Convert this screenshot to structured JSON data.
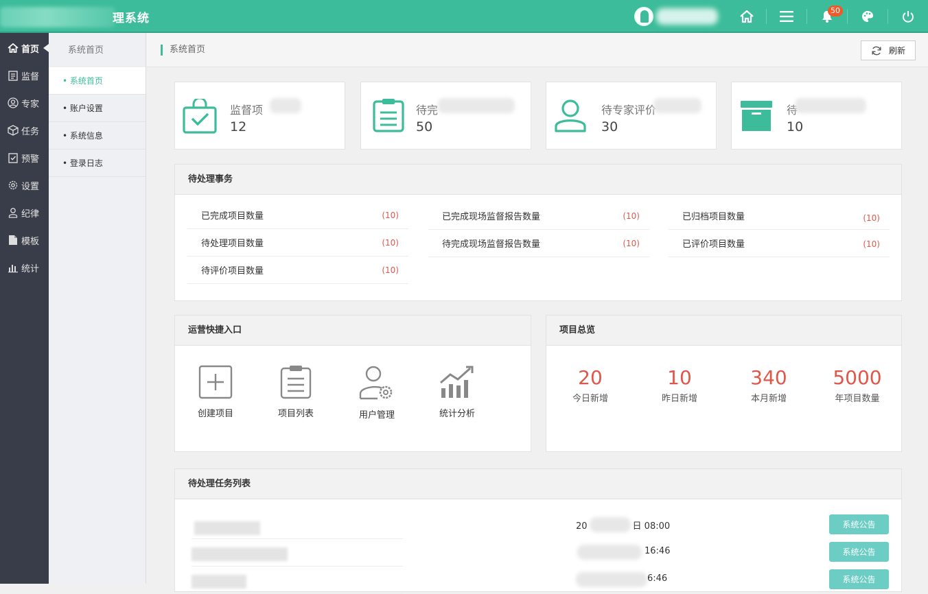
{
  "header": {
    "app_title": "理系统",
    "notification_count": "50"
  },
  "sidebar": {
    "items": [
      {
        "label": "首页",
        "icon": "home-icon"
      },
      {
        "label": "监督",
        "icon": "clipboard-icon"
      },
      {
        "label": "专家",
        "icon": "user-circle-icon"
      },
      {
        "label": "任务",
        "icon": "cube-icon"
      },
      {
        "label": "预警",
        "icon": "check-clipboard-icon"
      },
      {
        "label": "设置",
        "icon": "gear-icon"
      },
      {
        "label": "纪律",
        "icon": "person-icon"
      },
      {
        "label": "模板",
        "icon": "file-icon"
      },
      {
        "label": "统计",
        "icon": "bar-chart-icon"
      }
    ]
  },
  "subnav": {
    "title": "系统首页",
    "items": [
      {
        "label": "• 系统首页"
      },
      {
        "label": "• 账户设置"
      },
      {
        "label": "• 系统信息"
      },
      {
        "label": "• 登录日志"
      }
    ]
  },
  "breadcrumb": {
    "current": "系统首页",
    "refresh_label": "刷新"
  },
  "stats": [
    {
      "label": "监督项",
      "value": "12",
      "icon": "bag-check-icon"
    },
    {
      "label": "待完",
      "value": "50",
      "icon": "clipboard-list-icon"
    },
    {
      "label": "待专家评价",
      "value": "30",
      "icon": "user-icon"
    },
    {
      "label": "待",
      "value": "10",
      "icon": "archive-box-icon"
    }
  ],
  "pending": {
    "title": "待处理事务",
    "items": [
      {
        "label": "已完成项目数量",
        "count": "(10)"
      },
      {
        "label": "待处理项目数量",
        "count": "(10)"
      },
      {
        "label": "待评价项目数量",
        "count": "(10)"
      },
      {
        "label": "已完成现场监督报告数量",
        "count": "(10)"
      },
      {
        "label": "待完成现场监督报告数量",
        "count": "(10)"
      },
      {
        "label": "已归档项目数量",
        "count": "(10)"
      },
      {
        "label": "已评价项目数量",
        "count": "(10)"
      }
    ]
  },
  "quick_entry": {
    "title": "运营快捷入口",
    "items": [
      {
        "label": "创建项目",
        "icon": "plus-square-icon"
      },
      {
        "label": "项目列表",
        "icon": "list-clipboard-icon"
      },
      {
        "label": "用户管理",
        "icon": "user-gear-icon"
      },
      {
        "label": "统计分析",
        "icon": "trend-chart-icon"
      }
    ]
  },
  "overview": {
    "title": "项目总览",
    "items": [
      {
        "value": "20",
        "label": "今日新增"
      },
      {
        "value": "10",
        "label": "昨日新增"
      },
      {
        "value": "340",
        "label": "本月新增"
      },
      {
        "value": "5000",
        "label": "年项目数量"
      }
    ]
  },
  "tasks": {
    "title": "待处理任务列表",
    "rows": [
      {
        "time_prefix": "20",
        "time_suffix": "日 08:00",
        "button": "系统公告"
      },
      {
        "time_prefix": "",
        "time_suffix": "16:46",
        "button": "系统公告"
      },
      {
        "time_prefix": "",
        "time_suffix": "6:46",
        "button": "系统公告"
      }
    ]
  },
  "colors": {
    "accent": "#3cbc9a",
    "sidebar_bg": "#393d49",
    "count_red": "#e0574a",
    "badge_orange": "#f05a2a",
    "task_button": "#6bcdc4"
  }
}
